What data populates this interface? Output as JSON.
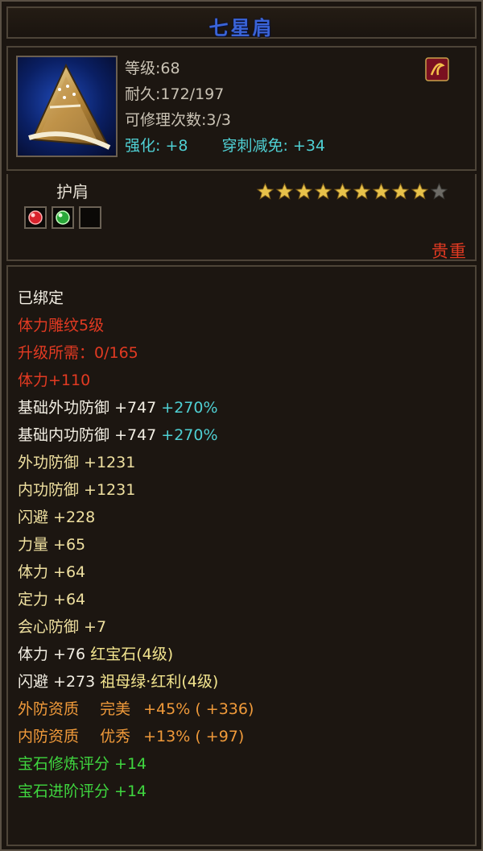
{
  "item": {
    "name": "七星肩",
    "level_line": "等级:68",
    "durability_line": "耐久:172/197",
    "repair_line": "可修理次数:3/3",
    "enhance_label": "强化:",
    "enhance_value": "+8",
    "pierce_label": "穿刺减免:",
    "pierce_value": "+34",
    "type": "护肩",
    "rarity": "贵重",
    "stars_filled": 9,
    "stars_total": 10,
    "sockets": [
      "ruby-gem-icon",
      "emerald-gem-icon",
      "empty-socket"
    ],
    "icon": "shoulder-armor-icon"
  },
  "attributes": {
    "bound": "已绑定",
    "engrave": "体力雕纹5级",
    "upgrade": "升级所需：0/165",
    "stamina_bonus": "体力+110",
    "base_ext_def_label": "基础外功防御",
    "base_ext_def_value": "+747",
    "base_ext_def_pct": "+270%",
    "base_int_def_label": "基础内功防御",
    "base_int_def_value": "+747",
    "base_int_def_pct": "+270%",
    "ext_def": "外功防御 +1231",
    "int_def": "内功防御 +1231",
    "dodge": "闪避 +228",
    "strength": "力量 +65",
    "stamina": "体力 +64",
    "focus": "定力 +64",
    "crit_def": "会心防御 +7",
    "gem1_stat": "体力 +76",
    "gem1_name": "红宝石(4级)",
    "gem2_stat": "闪避 +273",
    "gem2_name": "祖母绿·红利(4级)",
    "quality1_label": "外防资质",
    "quality1_grade": "完美",
    "quality1_value": "+45%",
    "quality1_extra": "( +336)",
    "quality2_label": "内防资质",
    "quality2_grade": "优秀",
    "quality2_value": "+13%",
    "quality2_extra": "( +97)",
    "gem_refine_score": "宝石修炼评分 +14",
    "gem_advance_score": "宝石进阶评分 +14"
  },
  "colors": {
    "title": "#3a64d8",
    "red": "#e23a22",
    "cyan": "#4fd0d4",
    "orange": "#f09a3a",
    "green": "#3fd63f",
    "star": "#e8c24a"
  }
}
